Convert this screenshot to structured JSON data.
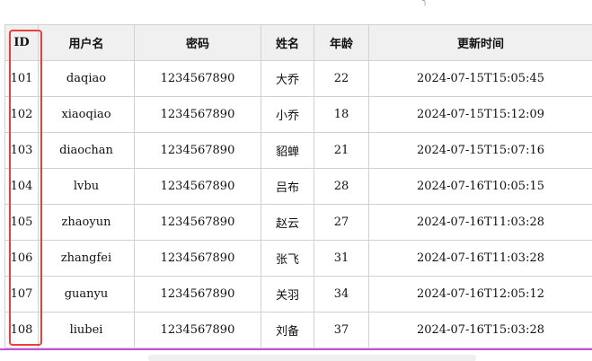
{
  "table": {
    "headers": [
      "ID",
      "用户名",
      "密码",
      "姓名",
      "年龄",
      "更新时间"
    ],
    "rows": [
      [
        "101",
        "daqiao",
        "1234567890",
        "大乔",
        "22",
        "2024-07-15T15:05:45"
      ],
      [
        "102",
        "xiaoqiao",
        "1234567890",
        "小乔",
        "18",
        "2024-07-15T15:12:09"
      ],
      [
        "103",
        "diaochan",
        "1234567890",
        "貂蝉",
        "21",
        "2024-07-15T15:07:16"
      ],
      [
        "104",
        "lvbu",
        "1234567890",
        "吕布",
        "28",
        "2024-07-16T10:05:15"
      ],
      [
        "105",
        "zhaoyun",
        "1234567890",
        "赵云",
        "27",
        "2024-07-16T11:03:28"
      ],
      [
        "106",
        "zhangfei",
        "1234567890",
        "张飞",
        "31",
        "2024-07-16T11:03:28"
      ],
      [
        "107",
        "guanyu",
        "1234567890",
        "关羽",
        "34",
        "2024-07-16T12:05:12"
      ],
      [
        "108",
        "liubei",
        "1234567890",
        "刘备",
        "37",
        "2024-07-16T15:03:28"
      ]
    ]
  },
  "colors": {
    "highlight": "#e8403b",
    "bottom_line": "#c94fd8",
    "header_bg": "#f0f0f0",
    "border": "#d2d2d2"
  }
}
